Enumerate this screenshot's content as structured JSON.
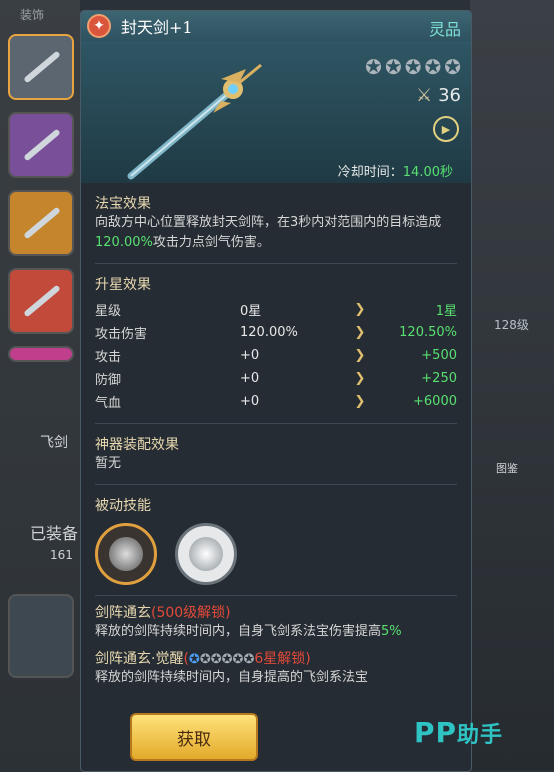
{
  "side": {
    "label": "装饰"
  },
  "background": {
    "tab_label": "飞剑",
    "equipped": "已装备",
    "level_count": "161",
    "level_badge": "128级",
    "atlas": "图鉴"
  },
  "panel": {
    "title": "封天剑+1",
    "quality": "灵品",
    "stars": 5,
    "power": "36",
    "cooldown": {
      "label": "冷却时间：",
      "value": "14.00秒"
    }
  },
  "effect": {
    "title": "法宝效果",
    "text_a": "向敌方中心位置释放封天剑阵，在3秒内对范围内的目标造成",
    "text_highlight": "120.00%",
    "text_b": "攻击力点剑气伤害。"
  },
  "upgrade": {
    "title": "升星效果",
    "rows": [
      {
        "name": "星级",
        "current": "0星",
        "next": "1星"
      },
      {
        "name": "攻击伤害",
        "current": "120.00%",
        "next": "120.50%"
      },
      {
        "name": "攻击",
        "current": "+0",
        "next": "+500"
      },
      {
        "name": "防御",
        "current": "+0",
        "next": "+250"
      },
      {
        "name": "气血",
        "current": "+0",
        "next": "+6000"
      }
    ]
  },
  "artifact": {
    "title": "神器装配效果",
    "value": "暂无"
  },
  "passive": {
    "title": "被动技能"
  },
  "skill1": {
    "name": "剑阵通玄",
    "lock": "(500级解锁)",
    "desc_a": "释放的剑阵持续时间内，自身飞剑系法宝伤害提高",
    "desc_highlight": "5%"
  },
  "skill2": {
    "name": "剑阵通玄·觉醒",
    "lock_open": "(",
    "lock_close": "6星解锁)",
    "desc": "释放的剑阵持续时间内，自身提高的飞剑系法宝"
  },
  "button": {
    "label": "获取"
  },
  "watermark": {
    "brand": "PP",
    "rest": "助手"
  },
  "colors": {
    "accent_green": "#58e070",
    "lock_red": "#e24a3a",
    "quality_cyan": "#7fe0d8",
    "button_gold": "#f0c040"
  }
}
